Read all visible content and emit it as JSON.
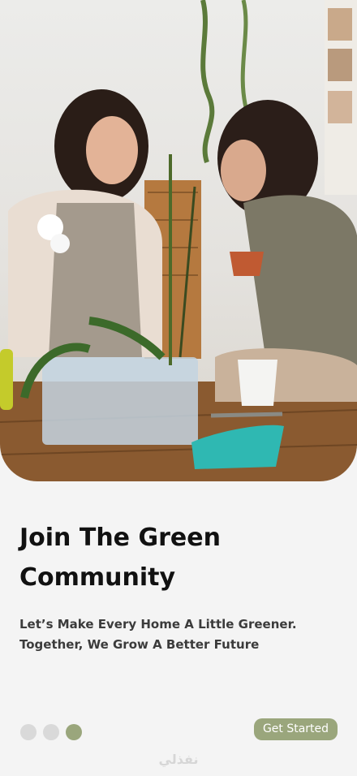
{
  "hero": {
    "image_name": "two-women-repotting-orchids"
  },
  "onboarding": {
    "title_line1": "Join The Green",
    "title_line2": "Community",
    "subtitle_line1": "Let’s Make Every Home A Little Greener.",
    "subtitle_line2": "Together, We Grow A Better Future",
    "page_count": 3,
    "active_page": 3,
    "cta_label": "Get Started"
  },
  "watermark": {
    "text": "نفذلي"
  },
  "colors": {
    "accent": "#9aa67c",
    "background": "#f4f4f4",
    "dot_inactive": "#d9d9d9",
    "title": "#111111",
    "subtitle": "#3b3b3b"
  }
}
